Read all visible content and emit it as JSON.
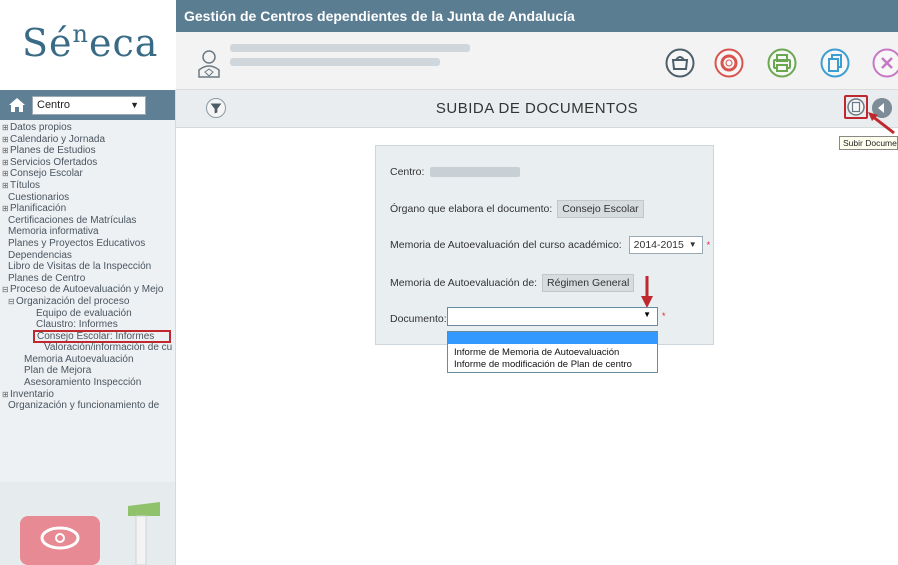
{
  "brand": {
    "logo_text_main": "Sé",
    "logo_text_sup": "n",
    "logo_text_end": "eca"
  },
  "header": {
    "title": "Gestión de Centros dependientes de la Junta de Andalucía"
  },
  "colors": {
    "header_bg": "#5b7d92",
    "highlight_red": "#c0282f",
    "dropdown_selected": "#3399ff"
  },
  "header_buttons": [
    {
      "name": "bag-icon",
      "color": "#4d5e69"
    },
    {
      "name": "lifebuoy-icon",
      "color": "#d9534f"
    },
    {
      "name": "printer-icon",
      "color": "#6aa84f"
    },
    {
      "name": "copy-icon",
      "color": "#3b9dd2"
    },
    {
      "name": "close-icon",
      "color": "#c778c4"
    }
  ],
  "sidebar": {
    "selector_value": "Centro",
    "items": [
      {
        "label": "Datos propios",
        "prefix": "⊞"
      },
      {
        "label": "Calendario y Jornada",
        "prefix": "⊞"
      },
      {
        "label": "Planes de Estudios",
        "prefix": "⊞"
      },
      {
        "label": "Servicios Ofertados",
        "prefix": "⊞"
      },
      {
        "label": "Consejo Escolar",
        "prefix": "⊞"
      },
      {
        "label": "Títulos",
        "prefix": "⊞"
      },
      {
        "label": "Cuestionarios",
        "prefix": ""
      },
      {
        "label": "Planificación",
        "prefix": "⊞"
      },
      {
        "label": "Certificaciones de Matrículas",
        "prefix": ""
      },
      {
        "label": "Memoria informativa",
        "prefix": ""
      },
      {
        "label": "Planes y Proyectos Educativos",
        "prefix": ""
      },
      {
        "label": "Dependencias",
        "prefix": ""
      },
      {
        "label": "Libro de Visitas de la Inspección",
        "prefix": ""
      },
      {
        "label": "Planes de Centro",
        "prefix": ""
      },
      {
        "label": "Proceso de Autoevaluación y Mejo",
        "prefix": "⊟"
      },
      {
        "label": "Organización del proceso",
        "prefix": "⊟"
      },
      {
        "label": "Equipo de evaluación",
        "prefix": ""
      },
      {
        "label": "Claustro: Informes",
        "prefix": ""
      },
      {
        "label": "Consejo Escolar: Informes",
        "prefix": ""
      },
      {
        "label": "Valoración/información de cu",
        "prefix": ""
      },
      {
        "label": "Memoria Autoevaluación",
        "prefix": ""
      },
      {
        "label": "Plan de Mejora",
        "prefix": ""
      },
      {
        "label": "Asesoramiento Inspección",
        "prefix": ""
      },
      {
        "label": "Inventario",
        "prefix": "⊞"
      },
      {
        "label": "Organización y funcionamiento de",
        "prefix": ""
      }
    ]
  },
  "main": {
    "title": "SUBIDA DE DOCUMENTOS",
    "tooltip": "Subir Documento",
    "form": {
      "centro_label": "Centro:",
      "organo_label": "Órgano que elabora el documento:",
      "organo_value": "Consejo Escolar",
      "memoria_curso_label": "Memoria de Autoevaluación del curso académico:",
      "memoria_curso_value": "2014-2015",
      "memoria_de_label": "Memoria de Autoevaluación de:",
      "memoria_de_value": "Régimen General",
      "documento_label": "Documento:",
      "required_mark": "*",
      "documento_options": [
        "",
        "Informe de Memoria de Autoevaluación",
        "Informe de modificación de Plan de centro"
      ]
    }
  }
}
